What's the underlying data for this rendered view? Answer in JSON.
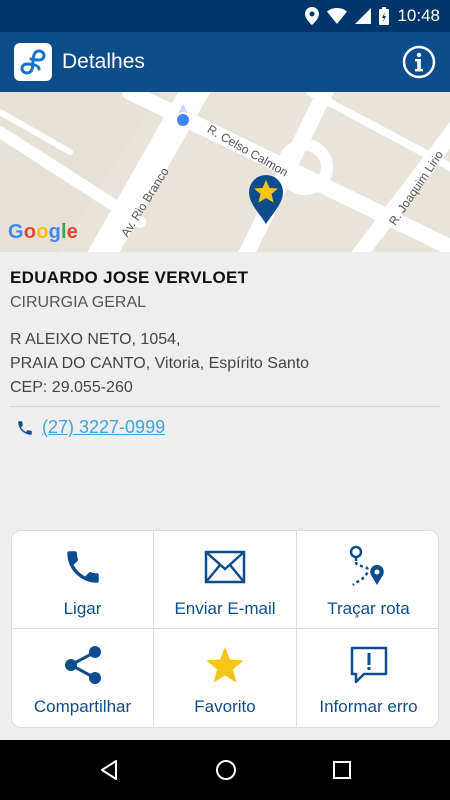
{
  "status_bar": {
    "time": "10:48"
  },
  "app_bar": {
    "title": "Detalhes",
    "logo_icon": "app-logo-icon",
    "info_icon": "info-icon"
  },
  "map": {
    "streets": [
      "R. Celso Calmon",
      "Av. Rio Branco",
      "R. Joaquim Lirio"
    ],
    "attribution": "Google"
  },
  "doctor": {
    "name": "EDUARDO JOSE VERVLOET",
    "specialty": "CIRURGIA GERAL",
    "address_line1": "R ALEIXO NETO, 1054,",
    "address_line2": "PRAIA DO CANTO, Vitoria, Espírito Santo",
    "cep": "CEP: 29.055-260",
    "phone": "(27) 3227-0999"
  },
  "actions": [
    {
      "label": "Ligar",
      "icon": "phone-icon"
    },
    {
      "label": "Enviar E-mail",
      "icon": "mail-icon"
    },
    {
      "label": "Traçar rota",
      "icon": "route-icon"
    },
    {
      "label": "Compartilhar",
      "icon": "share-icon"
    },
    {
      "label": "Favorito",
      "icon": "star-icon"
    },
    {
      "label": "Informar erro",
      "icon": "report-icon"
    }
  ],
  "colors": {
    "primary": "#0e4d8c",
    "status": "#00366b",
    "link": "#3fa4d8",
    "star": "#f5c518"
  }
}
